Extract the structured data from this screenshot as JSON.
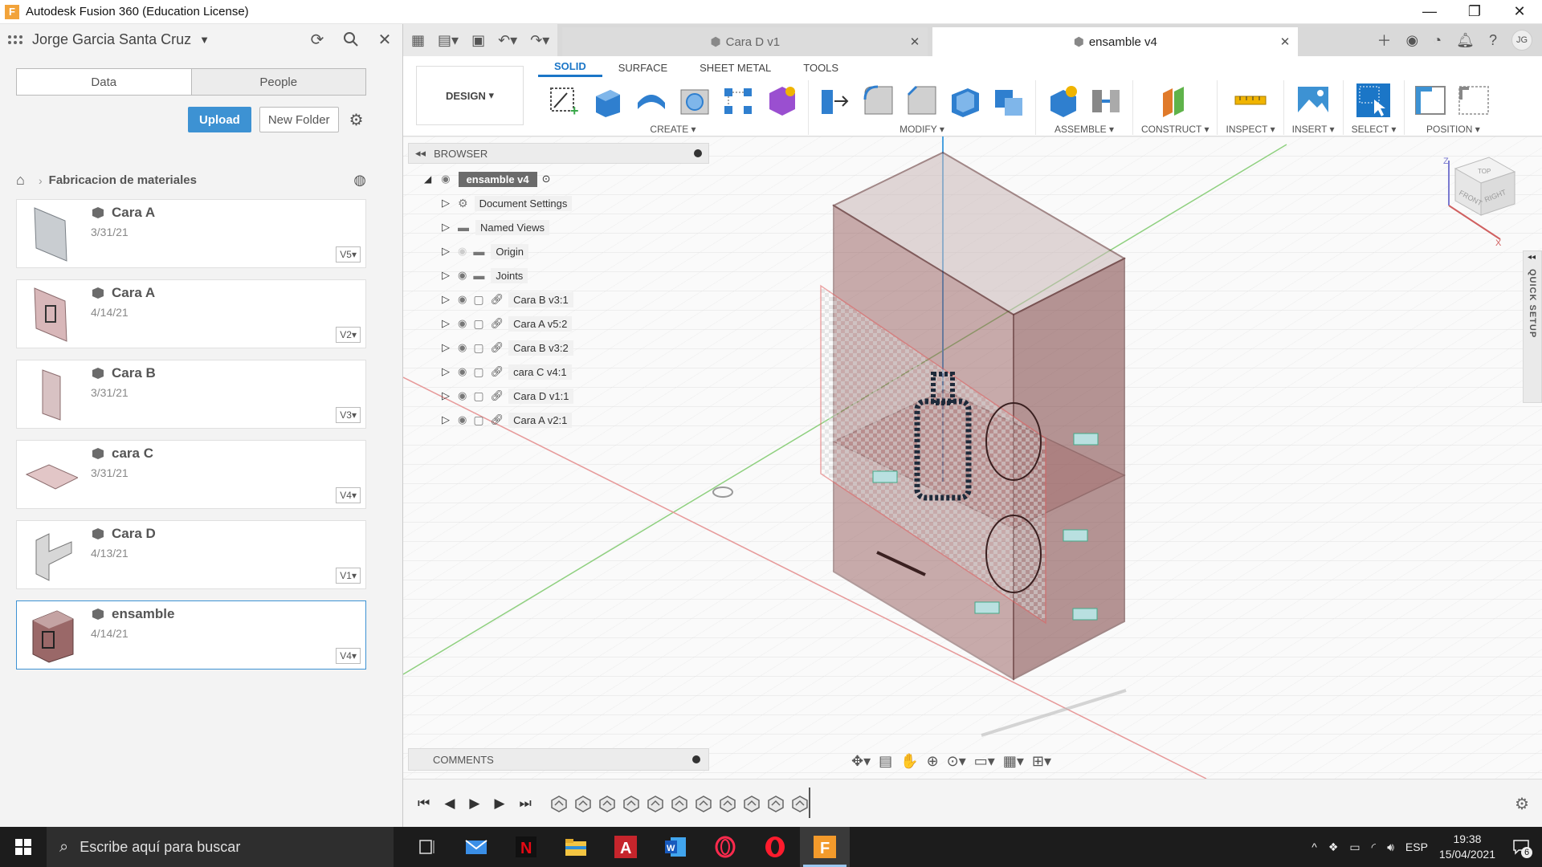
{
  "window": {
    "title": "Autodesk Fusion 360 (Education License)",
    "app_icon": "F"
  },
  "data_panel": {
    "user": "Jorge Garcia Santa Cruz",
    "tabs": [
      {
        "label": "Data",
        "active": true
      },
      {
        "label": "People",
        "active": false
      }
    ],
    "upload_label": "Upload",
    "new_folder_label": "New Folder",
    "breadcrumb": "Fabricacion de materiales",
    "files": [
      {
        "name": "Cara A",
        "date": "3/31/21",
        "version": "V5",
        "thumb": "plate-1"
      },
      {
        "name": "Cara A",
        "date": "4/14/21",
        "version": "V2",
        "thumb": "plate-2"
      },
      {
        "name": "Cara B",
        "date": "3/31/21",
        "version": "V3",
        "thumb": "plate-3"
      },
      {
        "name": "cara C",
        "date": "3/31/21",
        "version": "V4",
        "thumb": "plate-4"
      },
      {
        "name": "Cara D",
        "date": "4/13/21",
        "version": "V1",
        "thumb": "plate-5"
      },
      {
        "name": "ensamble",
        "date": "4/14/21",
        "version": "V4",
        "thumb": "assembly",
        "selected": true
      }
    ]
  },
  "doc_tabs": [
    {
      "label": "Cara D v1",
      "active": false
    },
    {
      "label": "ensamble v4",
      "active": true
    }
  ],
  "account_initials": "JG",
  "toolbar": {
    "workspace": "DESIGN",
    "tabs": [
      "SOLID",
      "SURFACE",
      "SHEET METAL",
      "TOOLS"
    ],
    "active_tab": "SOLID",
    "groups": [
      {
        "label": "CREATE",
        "icons": 6
      },
      {
        "label": "MODIFY",
        "icons": 5
      },
      {
        "label": "ASSEMBLE",
        "icons": 2
      },
      {
        "label": "CONSTRUCT",
        "icons": 1
      },
      {
        "label": "INSPECT",
        "icons": 1
      },
      {
        "label": "INSERT",
        "icons": 1
      },
      {
        "label": "SELECT",
        "icons": 1
      },
      {
        "label": "POSITION",
        "icons": 2
      }
    ]
  },
  "browser": {
    "title": "BROWSER",
    "root": "ensamble v4",
    "items": [
      {
        "label": "Document Settings",
        "icon": "gear-icon",
        "eye": false,
        "link": false
      },
      {
        "label": "Named Views",
        "icon": "folder-icon",
        "eye": false,
        "link": false
      },
      {
        "label": "Origin",
        "icon": "folder-icon",
        "eye": true,
        "eye_hidden": true,
        "link": false
      },
      {
        "label": "Joints",
        "icon": "folder-icon",
        "eye": true,
        "link": false
      },
      {
        "label": "Cara B v3:1",
        "icon": "component-icon",
        "eye": true,
        "link": true
      },
      {
        "label": "Cara A v5:2",
        "icon": "component-icon",
        "eye": true,
        "link": true
      },
      {
        "label": "Cara B v3:2",
        "icon": "component-icon",
        "eye": true,
        "link": true
      },
      {
        "label": "cara C v4:1",
        "icon": "component-icon",
        "eye": true,
        "link": true
      },
      {
        "label": "Cara D v1:1",
        "icon": "component-icon",
        "eye": true,
        "link": true
      },
      {
        "label": "Cara A v2:1",
        "icon": "component-icon",
        "eye": true,
        "link": true
      }
    ]
  },
  "comments_label": "COMMENTS",
  "quick_setup_label": "QUICK SETUP",
  "viewcube": {
    "top": "TOP",
    "front": "FRONT",
    "right": "RIGHT",
    "axis_z": "Z",
    "axis_x": "X"
  },
  "timeline": {
    "feature_count": 11
  },
  "taskbar": {
    "search_placeholder": "Escribe aquí para buscar",
    "language": "ESP",
    "time": "19:38",
    "date": "15/04/2021",
    "notifications": "6",
    "apps": [
      "task-view",
      "mail",
      "netflix",
      "file-explorer",
      "autocad",
      "word",
      "opera-gx",
      "opera",
      "fusion360"
    ]
  },
  "colors": {
    "accent": "#3d92d3",
    "active_tab": "#1b76c7",
    "model_fill": "#8a4b4b",
    "taskbar_bg": "#1c1c1c"
  }
}
